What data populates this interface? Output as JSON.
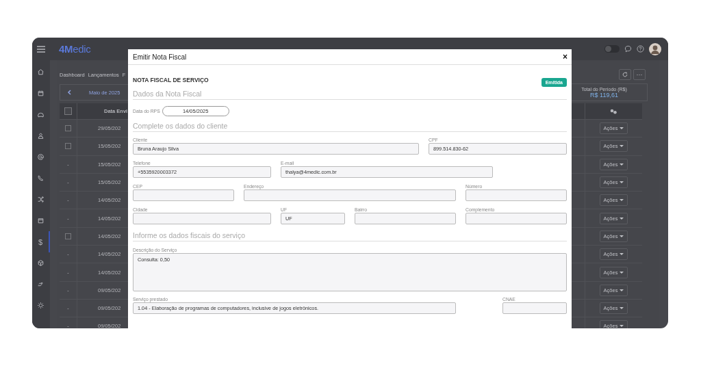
{
  "topbar": {
    "logo_bold": "4M",
    "logo_rest": "edic",
    "theme_toggle": {
      "on": false
    }
  },
  "sidebar": {
    "items": [
      {
        "selected": false
      },
      {
        "selected": false
      },
      {
        "selected": false
      },
      {
        "selected": false
      },
      {
        "selected": false
      },
      {
        "selected": false
      },
      {
        "selected": false
      },
      {
        "selected": false
      },
      {
        "label": "$",
        "selected": true
      },
      {
        "selected": false
      },
      {
        "selected": false
      },
      {
        "selected": false
      }
    ]
  },
  "breadcrumb": [
    "Dashboard",
    "Lançamentos",
    "F"
  ],
  "month_nav": {
    "label": "Maio de 2025"
  },
  "toolbar": {
    "more": "···"
  },
  "total": {
    "label": "Total do Período (R$)",
    "value": "R$ 119,61"
  },
  "table": {
    "select_all": {
      "checked": false
    },
    "columns": [
      "Data Envi"
    ],
    "rows": [
      {
        "select": {
          "kind": "checkbox",
          "checked": false
        },
        "date": "29/05/202",
        "action": "Ações"
      },
      {
        "select": {
          "kind": "checkbox",
          "checked": false
        },
        "date": "15/05/202",
        "action": "Ações"
      },
      {
        "select": {
          "kind": "text",
          "text": "-"
        },
        "date": "15/05/202",
        "action": "Ações"
      },
      {
        "select": {
          "kind": "text",
          "text": "-"
        },
        "date": "15/05/202",
        "action": "Ações"
      },
      {
        "select": {
          "kind": "text",
          "text": "-"
        },
        "date": "14/05/202",
        "action": "Ações"
      },
      {
        "select": {
          "kind": "text",
          "text": "-"
        },
        "date": "14/05/202",
        "action": "Ações"
      },
      {
        "select": {
          "kind": "checkbox",
          "checked": false
        },
        "date": "14/05/202",
        "action": "Ações"
      },
      {
        "select": {
          "kind": "text",
          "text": "-"
        },
        "date": "14/05/202",
        "action": "Ações"
      },
      {
        "select": {
          "kind": "text",
          "text": "-"
        },
        "date": "14/05/202",
        "action": "Ações"
      },
      {
        "select": {
          "kind": "text",
          "text": "-"
        },
        "date": "09/05/202",
        "action": "Ações"
      },
      {
        "select": {
          "kind": "text",
          "text": "-"
        },
        "date": "09/05/202",
        "action": "Ações"
      },
      {
        "select": {
          "kind": "text",
          "text": "-"
        },
        "date": "09/05/202",
        "action": "Ações"
      }
    ]
  },
  "modal": {
    "title": "Emitir Nota Fiscal",
    "close": "×",
    "heading": "NOTA FISCAL DE SERVIÇO",
    "status": "Emitida",
    "invoice_section": {
      "title": "Dados da Nota Fiscal",
      "rps_date": {
        "label": "Data do RPS",
        "value": "14/05/2025"
      }
    },
    "client_section": {
      "title": "Complete os dados do cliente",
      "fields": [
        {
          "label": "Cliente",
          "value": "Bruna Araujo Silva"
        },
        {
          "label": "CPF",
          "value": "899.514.830-62"
        },
        {
          "label": "Telefone",
          "value": "+5535920003372"
        },
        {
          "label": "E-mail",
          "value": "thalya@4medic.com.br"
        },
        {
          "label": "CEP"
        },
        {
          "label": "Endereço"
        },
        {
          "label": "Número"
        },
        {
          "label": "Cidade"
        },
        {
          "label": "UF",
          "value": "UF"
        },
        {
          "label": "Bairro"
        },
        {
          "label": "Complemento"
        }
      ]
    },
    "service_section": {
      "title": "Informe os dados fiscais do serviço",
      "description": {
        "label": "Descrição do Serviço",
        "value": "Consulta: 0,50"
      },
      "fields": [
        {
          "label": "Serviço prestado",
          "value": "1.04 - Elaboração de programas de computadores, inclusive de jogos eletrônicos."
        },
        {
          "label": "CNAE"
        }
      ]
    }
  }
}
